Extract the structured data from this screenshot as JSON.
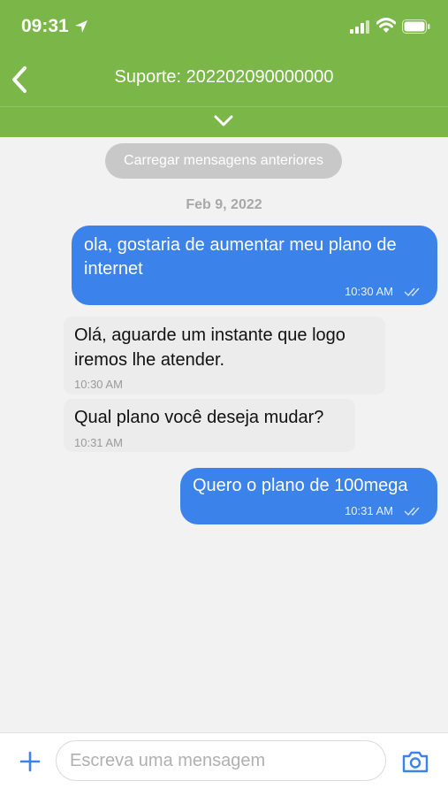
{
  "status_bar": {
    "time": "09:31"
  },
  "nav": {
    "title": "Suporte: 202202090000000"
  },
  "chat": {
    "load_more_label": "Carregar mensagens anteriores",
    "date_separator": "Feb 9, 2022",
    "messages": [
      {
        "direction": "outgoing",
        "lines": [
          "ola, gostaria de aumentar meu plano de",
          "internet"
        ],
        "time": "10:30 AM",
        "status": "read"
      },
      {
        "direction": "incoming",
        "lines": [
          "Olá, aguarde um instante que logo",
          "iremos lhe atender."
        ],
        "time": "10:30 AM"
      },
      {
        "direction": "incoming",
        "lines": [
          "Qual plano você deseja mudar?"
        ],
        "time": "10:31 AM"
      },
      {
        "direction": "outgoing",
        "lines": [
          "Quero o plano de 100mega"
        ],
        "time": "10:31 AM",
        "status": "read"
      }
    ]
  },
  "composer": {
    "placeholder": "Escreva uma mensagem"
  },
  "colors": {
    "header": "#7ab648",
    "outgoing_bubble": "#3b82ea",
    "incoming_bubble": "#ececec",
    "add_icon": "#3b82ea",
    "camera_icon": "#3b82ea"
  },
  "icons": {
    "back": "chevron-left-icon",
    "expand": "chevron-down-icon",
    "location": "location-arrow-icon",
    "signal": "cellular-signal-icon",
    "wifi": "wifi-icon",
    "battery": "battery-icon",
    "read_receipt": "double-check-icon",
    "add": "plus-icon",
    "camera": "camera-icon"
  }
}
